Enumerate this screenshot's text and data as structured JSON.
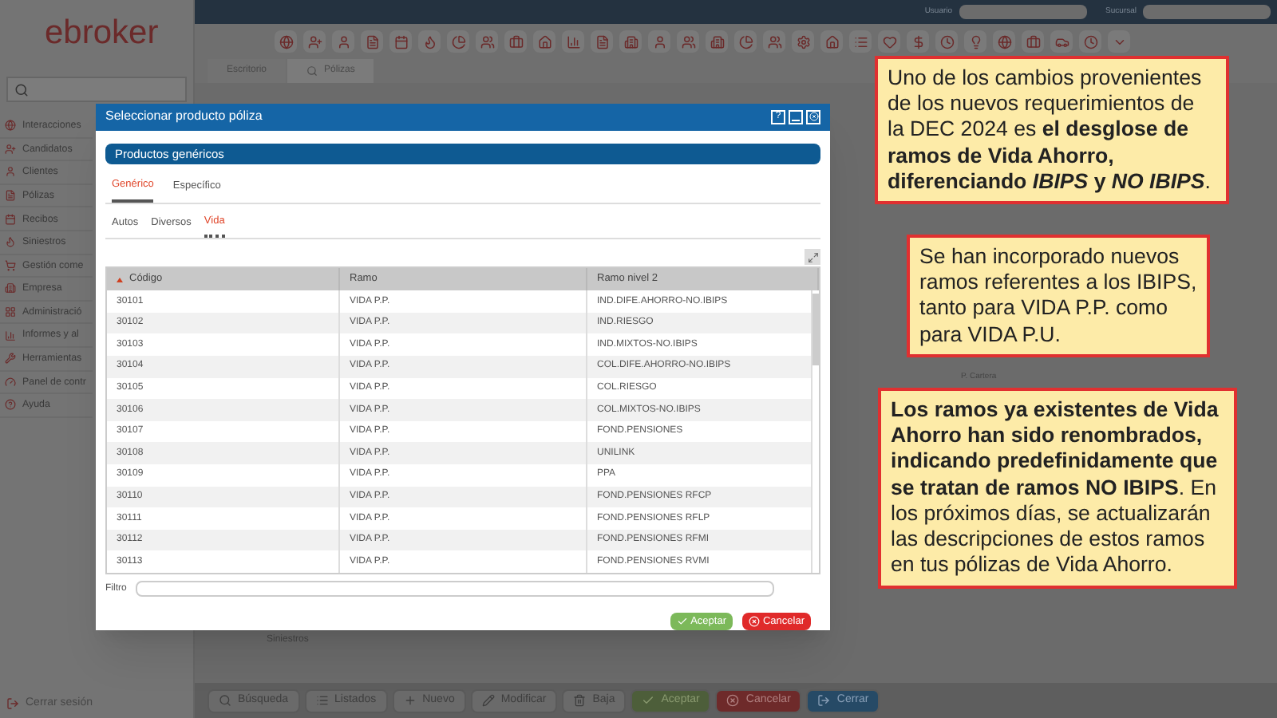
{
  "header": {
    "logo": "ebroker",
    "user_label": "Usuario",
    "branch_label": "Sucursal"
  },
  "sidebar": {
    "items": [
      {
        "label": "Interacciones"
      },
      {
        "label": "Candidatos"
      },
      {
        "label": "Clientes"
      },
      {
        "label": "Pólizas"
      },
      {
        "label": "Recibos"
      },
      {
        "label": "Siniestros"
      },
      {
        "label": "Gestión come"
      },
      {
        "label": "Empresa"
      },
      {
        "label": "Administració"
      },
      {
        "label": "Informes y al"
      },
      {
        "label": "Herramientas"
      },
      {
        "label": "Panel de contr"
      },
      {
        "label": "Ayuda"
      }
    ],
    "logout": "Cerrar sesión"
  },
  "page_tabs": [
    {
      "label": "Escritorio",
      "selected": false
    },
    {
      "label": "Pólizas",
      "selected": true
    }
  ],
  "background_labels": {
    "tab": "Siniestros",
    "field": "P. Cartera"
  },
  "bottom_toolbar": [
    {
      "label": "Búsqueda",
      "kind": "plain"
    },
    {
      "label": "Listados",
      "kind": "plain"
    },
    {
      "label": "Nuevo",
      "kind": "plain"
    },
    {
      "label": "Modificar",
      "kind": "plain"
    },
    {
      "label": "Baja",
      "kind": "plain"
    },
    {
      "label": "Aceptar",
      "kind": "accept"
    },
    {
      "label": "Cancelar",
      "kind": "cancel"
    },
    {
      "label": "Cerrar",
      "kind": "close"
    }
  ],
  "dialog": {
    "title": "Seleccionar producto póliza",
    "title_buttons": [
      "?"
    ],
    "section": "Productos genéricos",
    "tabs": [
      {
        "label": "Genérico",
        "selected": true
      },
      {
        "label": "Específico",
        "selected": false
      }
    ],
    "subtabs": [
      {
        "label": "Autos",
        "selected": false
      },
      {
        "label": "Diversos",
        "selected": false
      },
      {
        "label": "Vida",
        "selected": true
      }
    ],
    "table": {
      "columns": [
        "Código",
        "Ramo",
        "Ramo nivel 2"
      ],
      "rows": [
        [
          "30101",
          "VIDA P.P.",
          "IND.DIFE.AHORRO-NO.IBIPS"
        ],
        [
          "30102",
          "VIDA P.P.",
          "IND.RIESGO"
        ],
        [
          "30103",
          "VIDA P.P.",
          "IND.MIXTOS-NO.IBIPS"
        ],
        [
          "30104",
          "VIDA P.P.",
          "COL.DIFE.AHORRO-NO.IBIPS"
        ],
        [
          "30105",
          "VIDA P.P.",
          "COL.RIESGO"
        ],
        [
          "30106",
          "VIDA P.P.",
          "COL.MIXTOS-NO.IBIPS"
        ],
        [
          "30107",
          "VIDA P.P.",
          "FOND.PENSIONES"
        ],
        [
          "30108",
          "VIDA P.P.",
          "UNILINK"
        ],
        [
          "30109",
          "VIDA P.P.",
          "PPA"
        ],
        [
          "30110",
          "VIDA P.P.",
          "FOND.PENSIONES RFCP"
        ],
        [
          "30111",
          "VIDA P.P.",
          "FOND.PENSIONES RFLP"
        ],
        [
          "30112",
          "VIDA P.P.",
          "FOND.PENSIONES RFMI"
        ],
        [
          "30113",
          "VIDA P.P.",
          "FOND.PENSIONES RVMI"
        ]
      ]
    },
    "filter_label": "Filtro",
    "buttons": [
      {
        "label": "Aceptar",
        "kind": "accept"
      },
      {
        "label": "Cancelar",
        "kind": "cancel"
      }
    ]
  },
  "callouts": [
    {
      "parts": [
        {
          "text": "Uno de los cambios provenientes de los nuevos requerimientos de la DEC 2024 es ",
          "bold": false,
          "italic": false
        },
        {
          "text": "el desglose de ramos de Vida Ahorro, diferenciando ",
          "bold": true,
          "italic": false
        },
        {
          "text": "IBIPS",
          "bold": true,
          "italic": true
        },
        {
          "text": " y ",
          "bold": true,
          "italic": false
        },
        {
          "text": "NO IBIPS",
          "bold": true,
          "italic": true
        },
        {
          "text": ".",
          "bold": false,
          "italic": false
        }
      ]
    },
    {
      "parts": [
        {
          "text": "Se han incorporado nuevos ramos referentes a los IBIPS, tanto para VIDA P.P. como para VIDA P.U.",
          "bold": false,
          "italic": false
        }
      ]
    },
    {
      "parts": [
        {
          "text": "Los ramos ya existentes de Vida Ahorro han sido renombrados, indicando predefinidamente que se tratan de ramos NO IBIPS",
          "bold": true,
          "italic": false
        },
        {
          "text": ". En los próximos días, se actualizarán las descripciones de estos ramos en tus pólizas de Vida Ahorro.",
          "bold": false,
          "italic": false
        }
      ]
    }
  ]
}
